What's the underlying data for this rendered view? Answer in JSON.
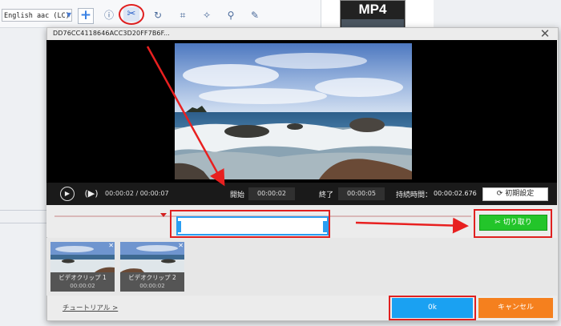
{
  "toolbar": {
    "audio_track": "English aac (LC)",
    "add_symbol": "+"
  },
  "format_thumb": {
    "label": "MP4"
  },
  "dialog": {
    "title": "DD76CC4118646ACC3D20FF7B6F...",
    "close_symbol": "✕"
  },
  "player": {
    "time_display": "00:00:02 / 00:00:07",
    "start_label": "開始",
    "start_time": "00:00:02",
    "end_label": "終了",
    "end_time": "00:00:05",
    "duration_label": "持続時間：",
    "duration_value": "00:00:02.676",
    "reset_label": "初期設定"
  },
  "cut_button": {
    "label": "切り取り"
  },
  "clips": [
    {
      "label": "ビデオクリップ 1",
      "time": "00:00:02"
    },
    {
      "label": "ビデオクリップ 2",
      "time": "00:00:02"
    }
  ],
  "footer": {
    "tutorial": "チュートリアル >",
    "ok": "0k",
    "cancel": "キャンセル"
  },
  "colors": {
    "highlight": "#e02020",
    "selection": "#2a9ef2",
    "cut_button": "#23c52a",
    "ok_button": "#1aa1f2",
    "cancel_button": "#f5801e"
  }
}
